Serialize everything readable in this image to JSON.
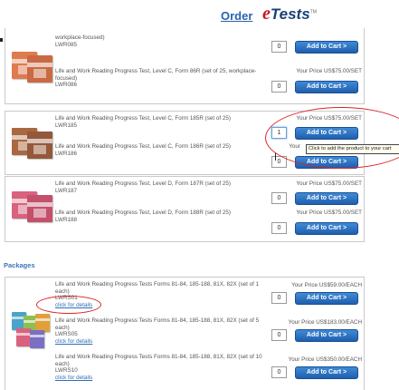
{
  "header": {
    "order_label": "Order",
    "logo_e": "e",
    "logo_tests": "Tests",
    "logo_tm": "TM"
  },
  "groups": [
    {
      "color": "#e07a4f",
      "rows": [
        {
          "title": "workplace-focused)",
          "code": "LWR085",
          "qty": "0",
          "price": "",
          "button": "Add to Cart >"
        },
        {
          "title": "Life and Work Reading Progress Test, Level C, Form 86R (set of 25, workplace-focused)",
          "code": "LWR086",
          "qty": "0",
          "price": "Your Price US$75.00/SET",
          "button": "Add to Cart >"
        }
      ]
    },
    {
      "color": "#a9683f",
      "rows": [
        {
          "title": "Life and Work Reading Progress Test, Level C, Form 185R (set of 25)",
          "code": "LWR185",
          "qty": "1",
          "price": "Your Price US$75.00/SET",
          "button": "Add to Cart >"
        },
        {
          "title": "Life and Work Reading Progress Test, Level C, Form 186R (set of 25)",
          "code": "LWR186",
          "qty": "0",
          "price": "Your",
          "button": "Add to Cart >"
        }
      ]
    },
    {
      "color": "#d9627e",
      "rows": [
        {
          "title": "Life and Work Reading Progress Test, Level D, Form 187R (set of 25)",
          "code": "LWR187",
          "qty": "0",
          "price": "Your Price US$75.00/SET",
          "button": "Add to Cart >"
        },
        {
          "title": "Life and Work Reading Progress Test, Level D, Form 188R (set of 25)",
          "code": "LWR188",
          "qty": "0",
          "price": "Your Price US$75.00/SET",
          "button": "Add to Cart >"
        }
      ]
    }
  ],
  "packages": {
    "title": "Packages",
    "rows": [
      {
        "title": "Life and Work Reading Progress Tests Forms 81-84, 185-188, 81X, 82X (set of 1 each)",
        "code": "LWRS01",
        "link": "click for details",
        "qty": "0",
        "price": "Your Price US$59.00/EACH",
        "button": "Add to Cart >"
      },
      {
        "title": "Life and Work Reading Progress Tests Forms 81-84, 185-188, 81X, 82X (set of 5 each)",
        "code": "LWRS05",
        "link": "click for details",
        "qty": "0",
        "price": "Your Price US$183.00/EACH",
        "button": "Add to Cart >"
      },
      {
        "title": "Life and Work Reading Progress Tests Forms 81-84, 185-188, 81X, 82X (set of 10 each)",
        "code": "LWRS10",
        "link": "click for details",
        "qty": "0",
        "price": "Your Price US$350.00/EACH",
        "button": "Add to Cart >"
      }
    ]
  },
  "tooltip": "Click to add the product to your cart",
  "colors": {
    "accent_blue": "#2a62b0",
    "button_blue": "#1f5fae",
    "annotation_red": "#d9232a",
    "package_books": [
      "#4aa3c9",
      "#8cc04f",
      "#e0a03c",
      "#d9627e",
      "#7a6fc2"
    ]
  }
}
